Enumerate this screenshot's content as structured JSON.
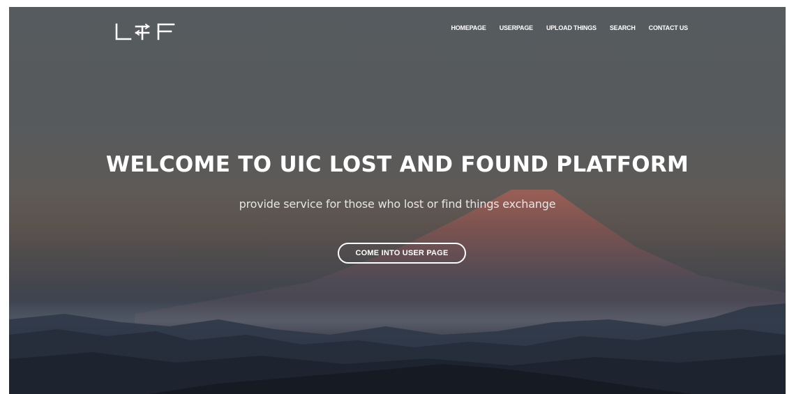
{
  "brand": {
    "logo_text": "L⇄F"
  },
  "nav": {
    "items": [
      "HOMEPAGE",
      "USERPAGE",
      "UPLOAD THINGS",
      "SEARCH",
      "CONTACT US"
    ]
  },
  "hero": {
    "title": "WELCOME TO UIC LOST AND FOUND PLATFORM",
    "subtitle": "provide service for those who lost or find things exchange",
    "cta_label": "COME INTO USER PAGE"
  },
  "colors": {
    "text": "#ffffff",
    "subtitle": "#e6e6e6"
  }
}
